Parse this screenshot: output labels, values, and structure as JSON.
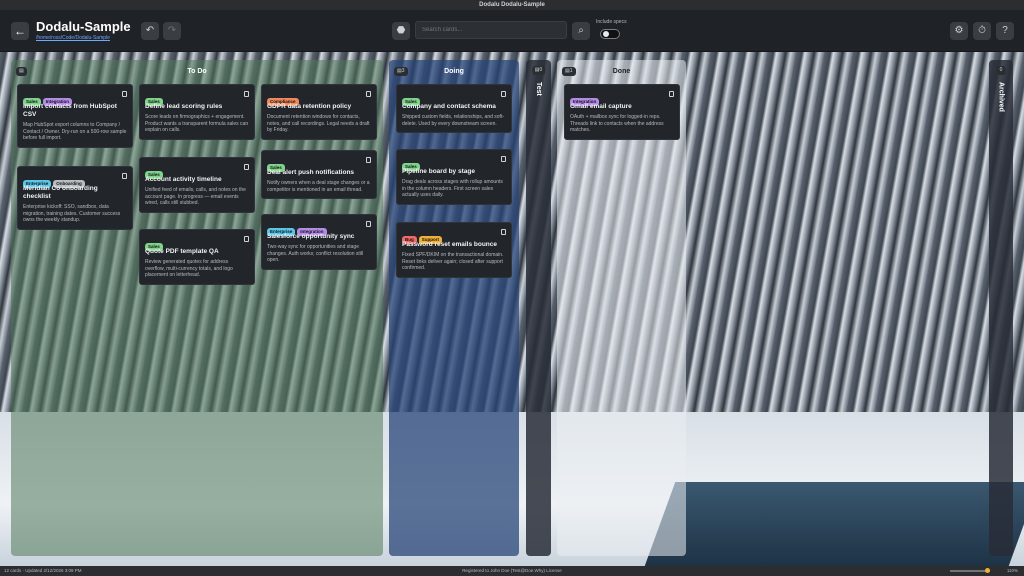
{
  "window": {
    "title": "Dodalu Dodalu-Sample"
  },
  "header": {
    "title": "Dodalu-Sample",
    "path": "/home/ross/Code/Dodalu-Sample",
    "search_placeholder": "Search cards...",
    "toggle_label": "Include specs"
  },
  "columns": {
    "todo": {
      "title": "To Do",
      "count": ""
    },
    "doing": {
      "title": "Doing",
      "count": "3"
    },
    "test": {
      "title": "Test",
      "count": "0"
    },
    "done": {
      "title": "Done",
      "count": "1"
    },
    "archived": {
      "title": "Archived",
      "count": "0"
    }
  },
  "cards": {
    "c1": {
      "tags": [
        "Sales",
        "Integration"
      ],
      "title": "Import contacts from HubSpot CSV",
      "desc": "Map HubSpot export columns to Company / Contact / Owner. Dry-run on a 500-row sample before full import."
    },
    "c2": {
      "tags": [
        "Enterprise",
        "Onboarding"
      ],
      "title": "Meridian Co onboarding checklist",
      "desc": "Enterprise kickoff: SSO, sandbox, data migration, training dates. Customer success owns the weekly standup."
    },
    "c3": {
      "tags": [
        "Sales"
      ],
      "title": "Define lead scoring rules",
      "desc": "Score leads on firmographics + engagement. Product wants a transparent formula sales can explain on calls."
    },
    "c4": {
      "tags": [
        "Sales"
      ],
      "title": "Account activity timeline",
      "desc": "Unified feed of emails, calls, and notes on the account page. In progress — email events wired, calls still stubbed."
    },
    "c5": {
      "tags": [
        "Sales"
      ],
      "title": "Quote PDF template QA",
      "desc": "Review generated quotes for address overflow, multi-currency totals, and logo placement on letterhead."
    },
    "c6": {
      "tags": [
        "Compliance"
      ],
      "title": "GDPR data retention policy",
      "desc": "Document retention windows for contacts, notes, and call recordings. Legal needs a draft by Friday."
    },
    "c7": {
      "tags": [
        "Sales"
      ],
      "title": "Deal alert push notifications",
      "desc": "Notify owners when a deal stage changes or a competitor is mentioned in an email thread."
    },
    "c8": {
      "tags": [
        "Enterprise",
        "Integration"
      ],
      "title": "Salesforce opportunity sync",
      "desc": "Two-way sync for opportunities and stage changes. Auth works; conflict resolution still open."
    },
    "c9": {
      "tags": [
        "Sales"
      ],
      "title": "Company and contact schema",
      "desc": "Shipped custom fields, relationships, and soft-delete. Used by every downstream screen."
    },
    "c10": {
      "tags": [
        "Sales"
      ],
      "title": "Pipeline board by stage",
      "desc": "Drag deals across stages with rollup amounts in the column headers. First screen sales actually uses daily."
    },
    "c11": {
      "tags": [
        "Bug",
        "Support"
      ],
      "title": "Password reset emails bounce",
      "desc": "Fixed SPF/DKIM on the transactional domain. Reset links deliver again; closed after support confirmed."
    },
    "c12": {
      "tags": [
        "Integration"
      ],
      "title": "Gmail email capture",
      "desc": "OAuth + mailbox sync for logged-in reps. Threads link to contacts when the address matches."
    }
  },
  "tag_colors": {
    "Sales": "#7fd38a",
    "Integration": "#b58be8",
    "Enterprise": "#5cc6e8",
    "Onboarding": "#b9bdc2",
    "Compliance": "#f08a5d",
    "Bug": "#ef6b6b",
    "Support": "#f0b13a"
  },
  "footer": {
    "left": "12 cards · Updated 2/12/2026 3:09 PM",
    "center": "Registered to John Doe (Test@Doe.Why) License",
    "zoom": "110%"
  }
}
